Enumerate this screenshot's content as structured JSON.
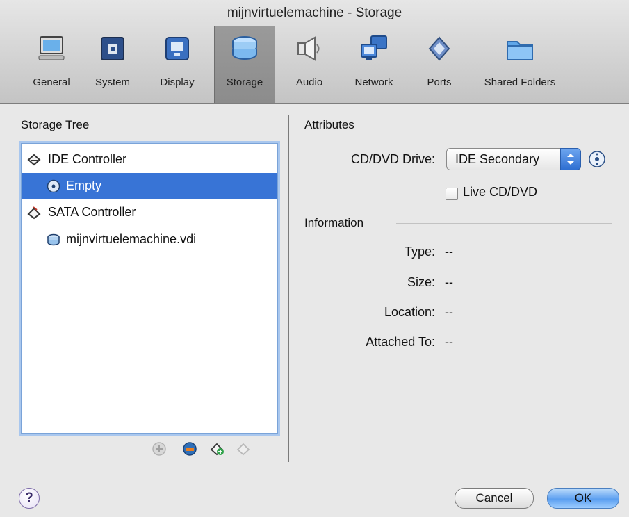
{
  "window": {
    "title": "mijnvirtuelemachine - Storage"
  },
  "toolbar": {
    "items": [
      {
        "label": "General",
        "icon": "monitor-icon"
      },
      {
        "label": "System",
        "icon": "chip-icon"
      },
      {
        "label": "Display",
        "icon": "display-icon"
      },
      {
        "label": "Storage",
        "icon": "storage-disks-icon",
        "active": true
      },
      {
        "label": "Audio",
        "icon": "speaker-icon"
      },
      {
        "label": "Network",
        "icon": "network-icon"
      },
      {
        "label": "Ports",
        "icon": "ports-icon"
      },
      {
        "label": "Shared Folders",
        "icon": "folder-icon"
      }
    ]
  },
  "storage_tree": {
    "heading": "Storage Tree",
    "items": [
      {
        "label": "IDE Controller",
        "icon": "ide-controller-icon"
      },
      {
        "label": "Empty",
        "icon": "cd-icon",
        "selected": true
      },
      {
        "label": "SATA Controller",
        "icon": "sata-controller-icon"
      },
      {
        "label": "mijnvirtuelemachine.vdi",
        "icon": "hard-disk-icon"
      }
    ],
    "actions": [
      "add-attachment-icon",
      "add-cd-icon",
      "add-controller-icon",
      "remove-controller-icon"
    ]
  },
  "attributes": {
    "heading": "Attributes",
    "drive_label": "CD/DVD Drive:",
    "drive_value": "IDE Secondary",
    "live_label": "Live CD/DVD",
    "live_checked": false
  },
  "information": {
    "heading": "Information",
    "rows": [
      {
        "label": "Type:",
        "value": "--"
      },
      {
        "label": "Size:",
        "value": "--"
      },
      {
        "label": "Location:",
        "value": "--"
      },
      {
        "label": "Attached To:",
        "value": "--"
      }
    ]
  },
  "footer": {
    "help": "?",
    "cancel": "Cancel",
    "ok": "OK"
  },
  "colors": {
    "selection": "#3874d6",
    "accent": "#5b9ff0"
  }
}
